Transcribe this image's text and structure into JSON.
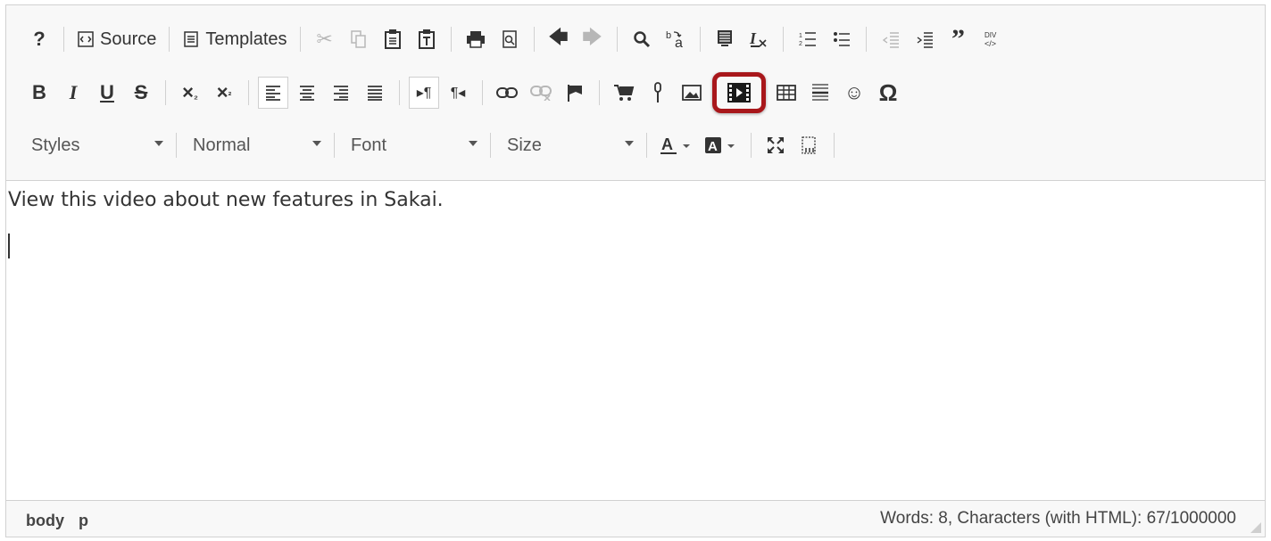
{
  "toolbar": {
    "row1": {
      "help": "?",
      "source_label": "Source",
      "templates_label": "Templates"
    },
    "row3": {
      "styles": "Styles",
      "format": "Normal",
      "font": "Font",
      "size": "Size"
    },
    "highlighted_button": "embed-video-button",
    "highlight_color": "#a8171b"
  },
  "content": {
    "paragraph": "View this video about new features in Sakai."
  },
  "statusbar": {
    "path": [
      "body",
      "p"
    ],
    "counter": "Words: 8, Characters (with HTML): 67/1000000"
  }
}
